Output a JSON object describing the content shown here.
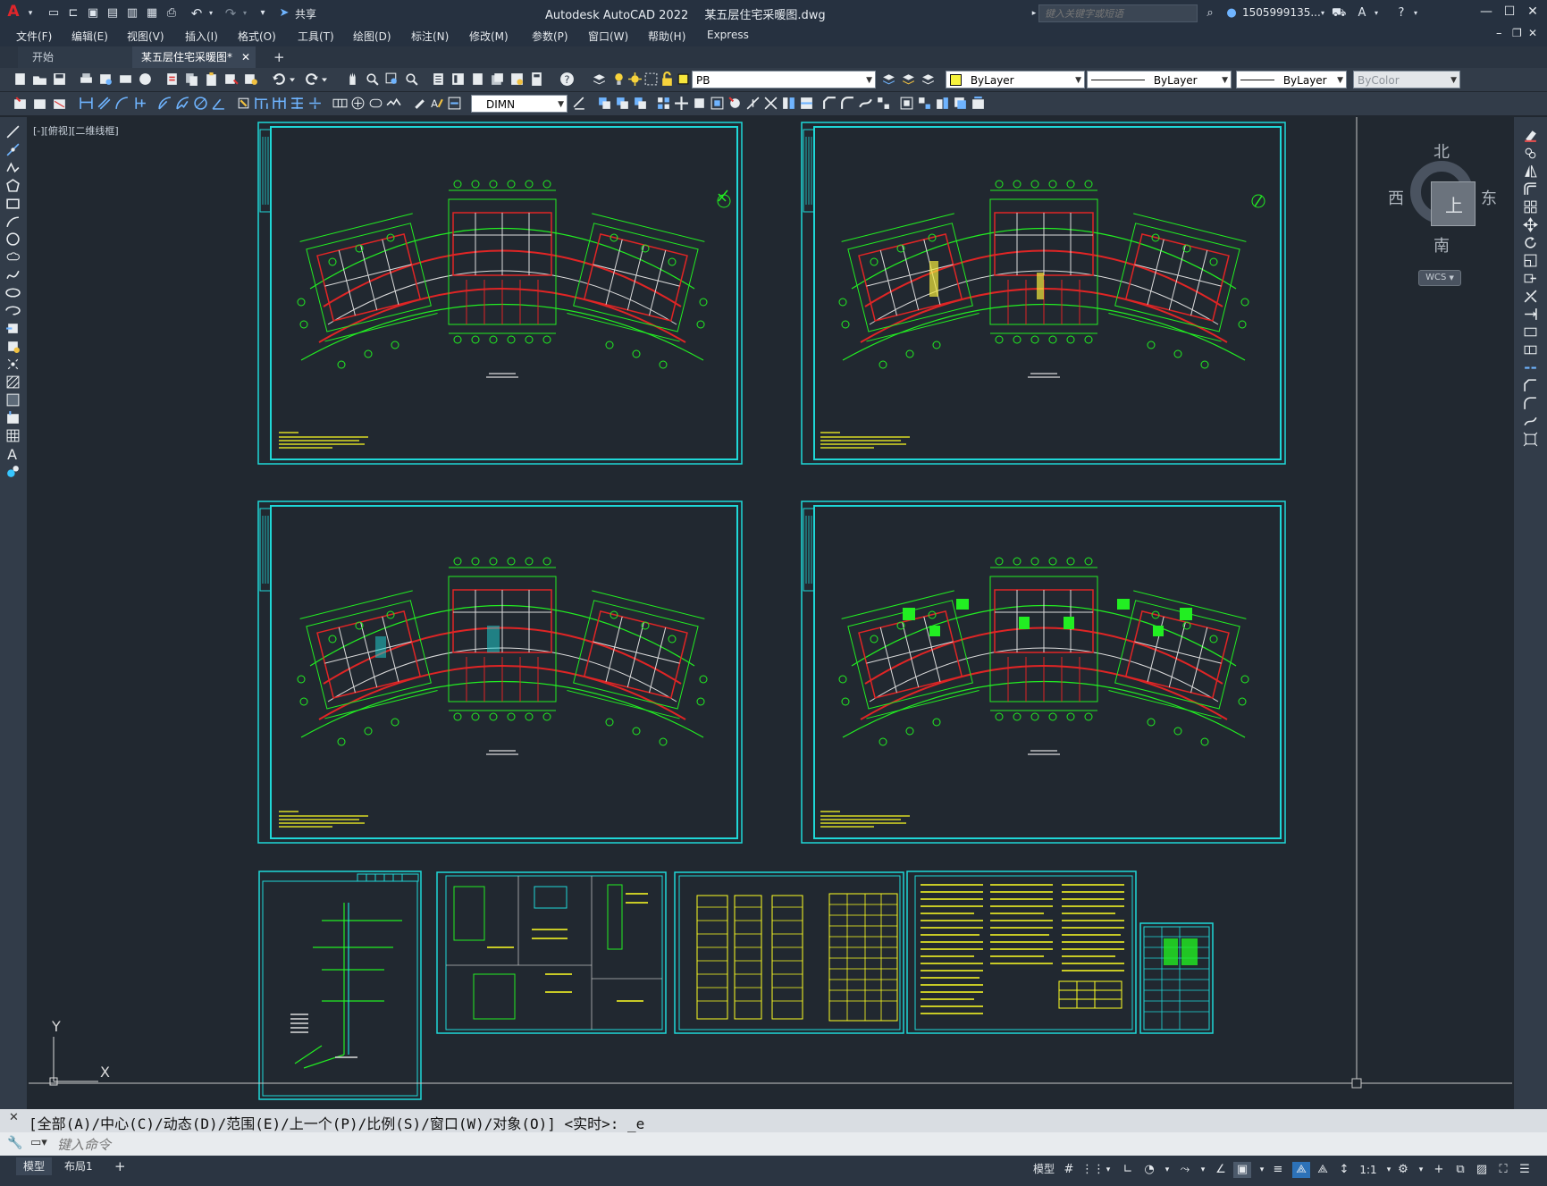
{
  "title_bar": {
    "app_title": "Autodesk AutoCAD 2022",
    "file_name": "某五层住宅采暖图.dwg",
    "share_label": "共享",
    "search_placeholder": "键入关键字或短语",
    "user_name": "1505999135..."
  },
  "menu": [
    "文件(F)",
    "编辑(E)",
    "视图(V)",
    "插入(I)",
    "格式(O)",
    "工具(T)",
    "绘图(D)",
    "标注(N)",
    "修改(M)",
    "参数(P)",
    "窗口(W)",
    "帮助(H)",
    "Express"
  ],
  "tabs": [
    {
      "label": "开始",
      "active": false
    },
    {
      "label": "某五层住宅采暖图*",
      "active": true
    }
  ],
  "toolbar1": {
    "layer_value": "PB",
    "color_value": "ByLayer",
    "linetype_value": "ByLayer",
    "lineweight_value": "ByLayer",
    "plotstyle_value": "ByColor"
  },
  "toolbar2": {
    "dimstyle_value": "DIMN"
  },
  "viewport_label": "[-][俯视][二维线框]",
  "viewcube": {
    "north": "北",
    "south": "南",
    "east": "东",
    "west": "西",
    "face": "上",
    "wcs": "WCS"
  },
  "ucs": {
    "x": "X",
    "y": "Y"
  },
  "command": {
    "history": "[全部(A)/中心(C)/动态(D)/范围(E)/上一个(P)/比例(S)/窗口(W)/对象(O)] <实时>: _e",
    "placeholder": "键入命令"
  },
  "status": {
    "layout_tabs": [
      "模型",
      "布局1"
    ],
    "model_label": "模型",
    "scale": "1:1"
  },
  "colors": {
    "drawing_bg": "#212830",
    "frame": "#1fd7d7",
    "plan_lines": "#22ee22",
    "walls": "#e02525",
    "notes": "#ffff22"
  }
}
